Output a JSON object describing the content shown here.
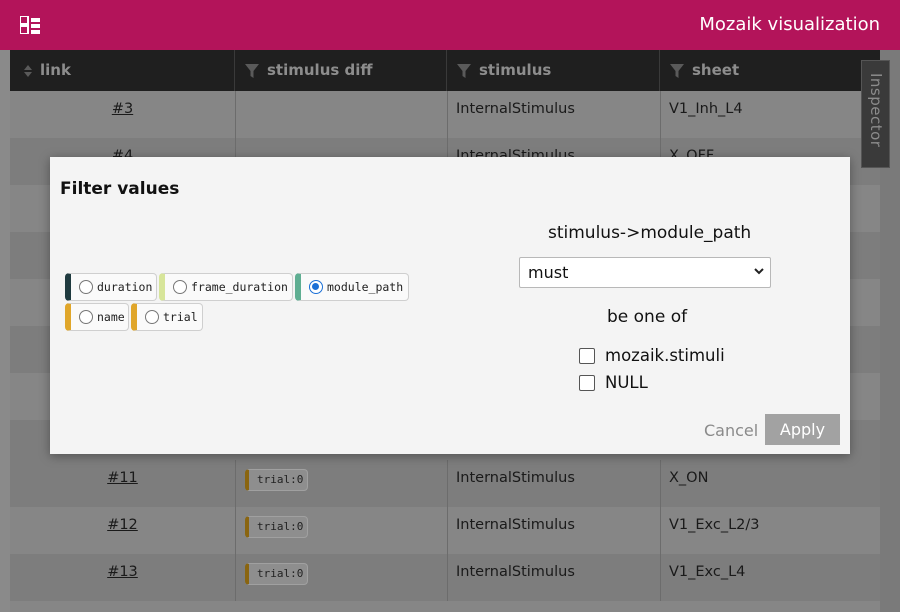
{
  "header": {
    "title": "Mozaik visualization",
    "menu_icon": "tree-menu-icon",
    "bg_color": "#b3145a"
  },
  "table": {
    "columns": [
      {
        "label": "link",
        "icon": "sort-icon"
      },
      {
        "label": "stimulus diff",
        "icon": "filter-icon"
      },
      {
        "label": "stimulus",
        "icon": "filter-icon"
      },
      {
        "label": "sheet",
        "icon": "filter-icon"
      }
    ],
    "rows": [
      {
        "link": "#3",
        "diff": "",
        "stimulus": "InternalStimulus",
        "sheet": "V1_Inh_L4"
      },
      {
        "link": "#4",
        "diff": "",
        "stimulus": "InternalStimulus",
        "sheet": "X_OFF"
      },
      {
        "link": "#11",
        "diff": "trial:0",
        "stimulus": "InternalStimulus",
        "sheet": "X_ON"
      },
      {
        "link": "#12",
        "diff": "trial:0",
        "stimulus": "InternalStimulus",
        "sheet": "V1_Exc_L2/3"
      },
      {
        "link": "#13",
        "diff": "trial:0",
        "stimulus": "InternalStimulus",
        "sheet": "V1_Exc_L4"
      }
    ]
  },
  "inspector": {
    "label": "Inspector"
  },
  "modal": {
    "title": "Filter values",
    "params": [
      {
        "label": "duration",
        "selected": false,
        "accent": "#1f3a3f"
      },
      {
        "label": "frame_duration",
        "selected": false,
        "accent": "#d7e59a"
      },
      {
        "label": "module_path",
        "selected": true,
        "accent": "#5fae92"
      },
      {
        "label": "name",
        "selected": false,
        "accent": "#e0a62a"
      },
      {
        "label": "trial",
        "selected": false,
        "accent": "#e0a62a"
      }
    ],
    "field_label": "stimulus->module_path",
    "condition": {
      "selected": "must"
    },
    "be_label": "be one of",
    "options": [
      {
        "label": "mozaik.stimuli",
        "checked": false
      },
      {
        "label": "NULL",
        "checked": false
      }
    ],
    "cancel_label": "Cancel",
    "apply_label": "Apply"
  }
}
